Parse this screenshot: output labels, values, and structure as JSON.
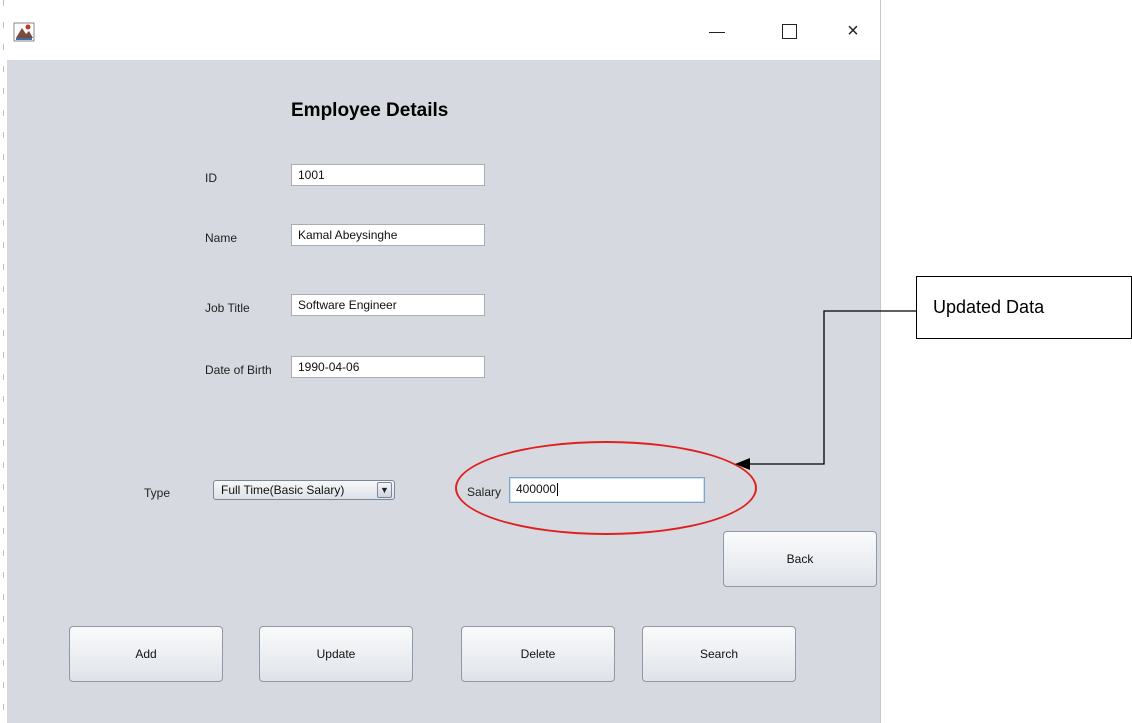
{
  "window": {
    "icon": "java-app-icon",
    "controls": {
      "minimize": "minimize-icon",
      "maximize": "maximize-icon",
      "close": "close-icon",
      "close_glyph": "×"
    }
  },
  "form": {
    "title": "Employee Details",
    "fields": {
      "id": {
        "label": "ID",
        "value": "1001"
      },
      "name": {
        "label": "Name",
        "value": "Kamal Abeysinghe"
      },
      "job_title": {
        "label": "Job Title",
        "value": "Software Engineer"
      },
      "dob": {
        "label": "Date of Birth",
        "value": "1990-04-06"
      },
      "salary": {
        "label": "Salary",
        "value": "400000"
      }
    },
    "type": {
      "label": "Type",
      "selected": "Full Time(Basic Salary)",
      "arrow": "▼"
    },
    "buttons": {
      "back": "Back",
      "add": "Add",
      "update": "Update",
      "delete": "Delete",
      "search": "Search"
    }
  },
  "annotation": {
    "callout_text": "Updated Data",
    "highlight_color": "#e02020"
  }
}
